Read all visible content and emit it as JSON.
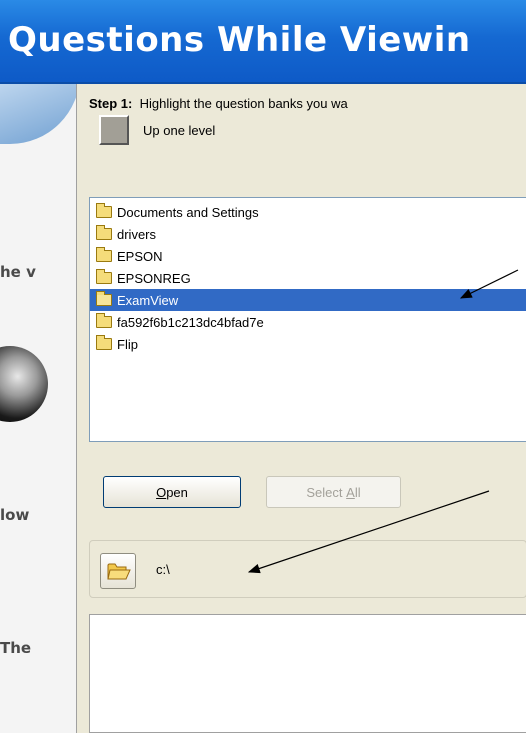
{
  "window": {
    "title": "Questions While Viewin"
  },
  "side_strip": {
    "fragments": [
      "he v",
      "low",
      "The"
    ]
  },
  "step1": {
    "label": "Step 1:",
    "text": "Highlight the question banks you wa"
  },
  "up_level": {
    "label": "Up one level"
  },
  "folders": [
    {
      "name": "Documents and Settings",
      "selected": false
    },
    {
      "name": "drivers",
      "selected": false
    },
    {
      "name": "EPSON",
      "selected": false
    },
    {
      "name": "EPSONREG",
      "selected": false
    },
    {
      "name": "ExamView",
      "selected": true
    },
    {
      "name": "fa592f6b1c213dc4bfad7e",
      "selected": false
    },
    {
      "name": "Flip",
      "selected": false
    }
  ],
  "buttons": {
    "open": {
      "mnemonic": "O",
      "rest": "pen"
    },
    "select_all": {
      "prefix": "Select ",
      "mnemonic": "A",
      "rest": "ll",
      "enabled": false
    }
  },
  "path": {
    "value": "c:\\"
  },
  "colors": {
    "titlebar": "#1569d2",
    "selection": "#316ac5",
    "panel": "#ece9d8"
  }
}
